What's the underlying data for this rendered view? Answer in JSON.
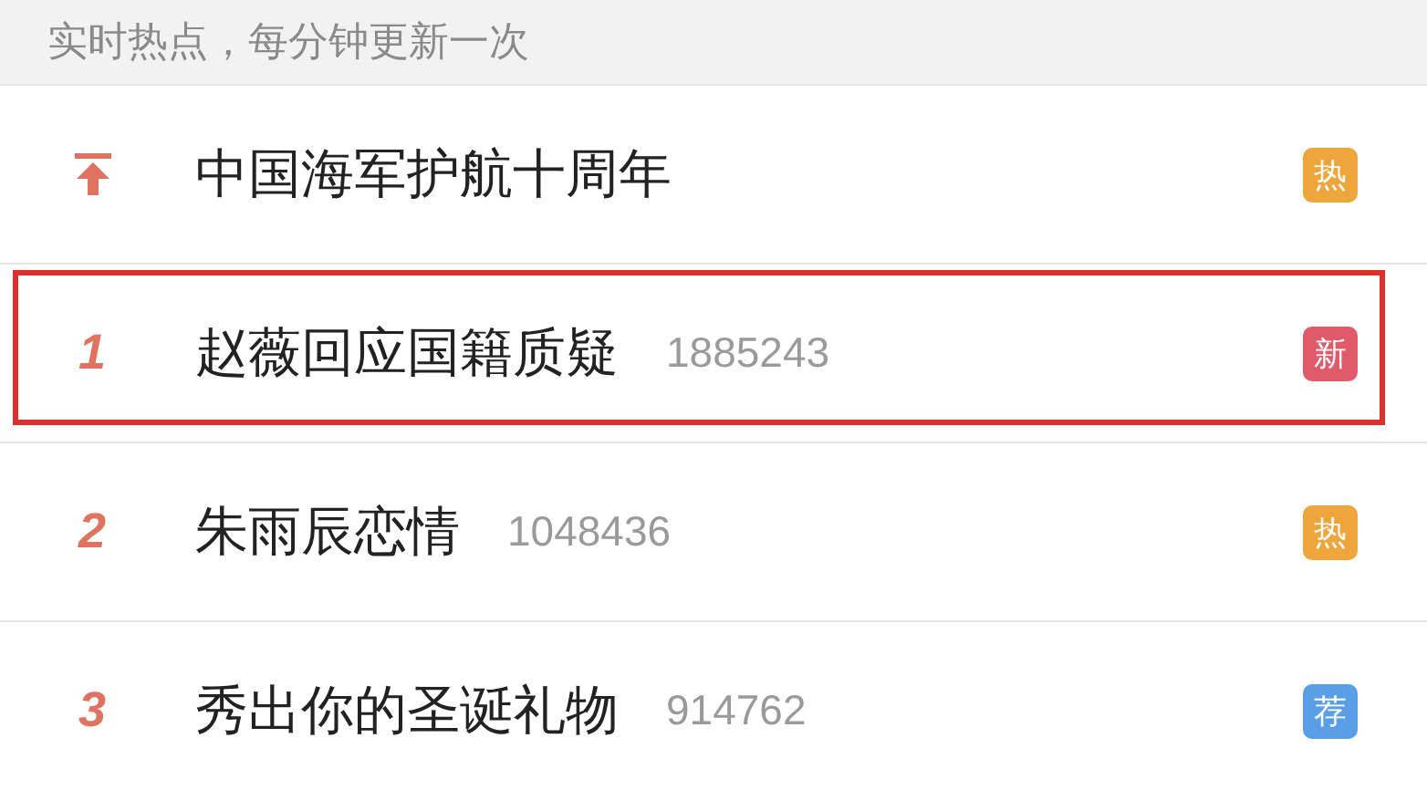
{
  "header": {
    "text": "实时热点，每分钟更新一次"
  },
  "items": [
    {
      "kind": "pinned",
      "title": "中国海军护航十周年",
      "badge": "热",
      "color": "#eea63c",
      "highlighted": false
    },
    {
      "kind": "ranked",
      "rank": "1",
      "title": "赵薇回应国籍质疑",
      "count": "1885243",
      "badge": "新",
      "color": "#e05a6a",
      "highlighted": true
    },
    {
      "kind": "ranked",
      "rank": "2",
      "title": "朱雨辰恋情",
      "count": "1048436",
      "badge": "热",
      "color": "#eea63c",
      "highlighted": false
    },
    {
      "kind": "ranked",
      "rank": "3",
      "title": "秀出你的圣诞礼物",
      "count": "914762",
      "badge": "荐",
      "color": "#5a9fe6",
      "highlighted": false
    }
  ]
}
